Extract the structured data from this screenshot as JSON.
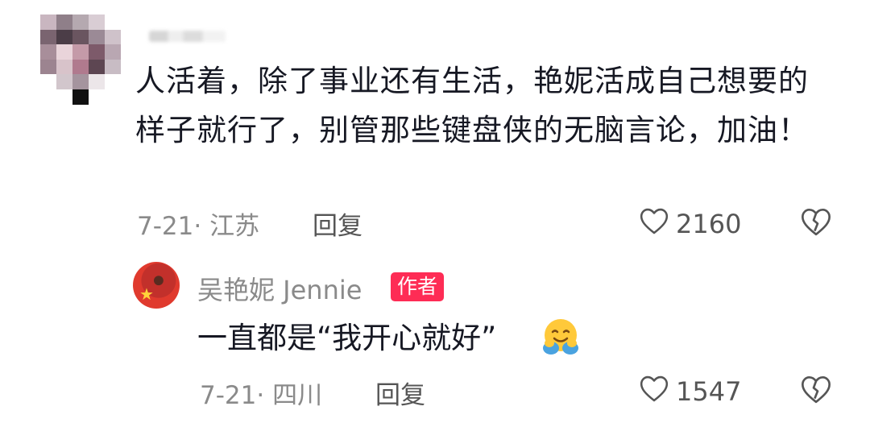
{
  "comment": {
    "text": "人活着，除了事业还有生活，艳妮活成自己想要的样子就行了，别管那些键盘侠的无脑言论，加油！",
    "date_location": "7-21· 江苏",
    "reply_label": "回复",
    "like_count": "2160"
  },
  "reply": {
    "author_name": "吴艳妮 Jennie",
    "author_badge": "作者",
    "text": "一直都是“我开心就好”",
    "emoji": "hugging-face",
    "date_location": "7-21· 四川",
    "reply_label": "回复",
    "like_count": "1547"
  },
  "colors": {
    "text": "#161823",
    "meta": "#8a8a8a",
    "badge": "#fe2c55"
  },
  "icons": [
    "heart-outline-icon",
    "broken-heart-icon"
  ]
}
